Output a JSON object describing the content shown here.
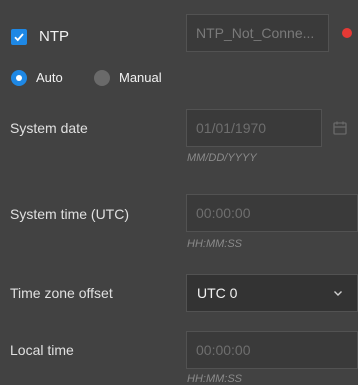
{
  "ntp": {
    "checked": true,
    "label": "NTP",
    "status_value": "NTP_Not_Conne...",
    "status_color": "#e53935"
  },
  "mode": {
    "options": [
      {
        "label": "Auto",
        "selected": true
      },
      {
        "label": "Manual",
        "selected": false
      }
    ]
  },
  "system_date": {
    "label": "System date",
    "value": "01/01/1970",
    "hint": "MM/DD/YYYY"
  },
  "system_time": {
    "label": "System time (UTC)",
    "value": "00:00:00",
    "hint": "HH:MM:SS"
  },
  "timezone": {
    "label": "Time zone offset",
    "selected": "UTC 0"
  },
  "local_time": {
    "label": "Local time",
    "value": "00:00:00",
    "hint": "HH:MM:SS"
  },
  "colors": {
    "background": "#424242",
    "accent": "#1e88e5",
    "status_error": "#e53935"
  },
  "icons": {
    "checkbox": "checkmark-icon",
    "date_picker": "calendar-icon",
    "dropdown": "chevron-down-icon"
  }
}
